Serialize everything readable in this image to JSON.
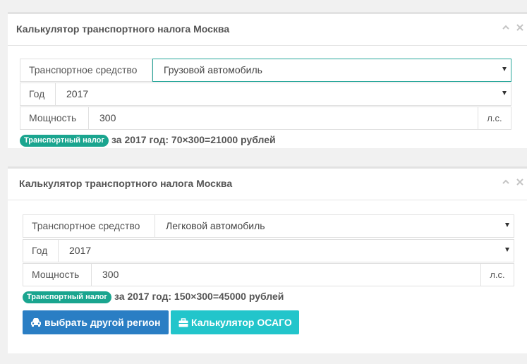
{
  "panels": [
    {
      "title": "Калькулятор транспортного налога Москва",
      "vehicle": {
        "label": "Транспортное средство",
        "value": "Грузовой автомобиль"
      },
      "year": {
        "label": "Год",
        "value": "2017"
      },
      "power": {
        "label": "Мощность",
        "value": "300",
        "unit": "л.с."
      },
      "result": {
        "badge": "Транспортный налог",
        "text": "за 2017 год: 70×300=21000 рублей"
      }
    },
    {
      "title": "Калькулятор транспортного налога Москва",
      "vehicle": {
        "label": "Транспортное средство",
        "value": "Легковой автомобиль"
      },
      "year": {
        "label": "Год",
        "value": "2017"
      },
      "power": {
        "label": "Мощность",
        "value": "300",
        "unit": "л.с."
      },
      "result": {
        "badge": "Транспортный налог",
        "text": "за 2017 год: 150×300=45000 рублей"
      },
      "buttons": {
        "region": "выбрать другой регион",
        "osago": "Калькулятор ОСАГО"
      }
    }
  ],
  "colors": {
    "badge": "#1aa58f",
    "button_blue": "#2a7ec4",
    "button_teal": "#22c5cb",
    "focus_border": "#26a69a"
  },
  "icons": {
    "collapse": "chevron-up-icon",
    "close": "close-icon",
    "car": "car-icon",
    "briefcase": "briefcase-icon",
    "dropdown": "caret-down-icon"
  }
}
